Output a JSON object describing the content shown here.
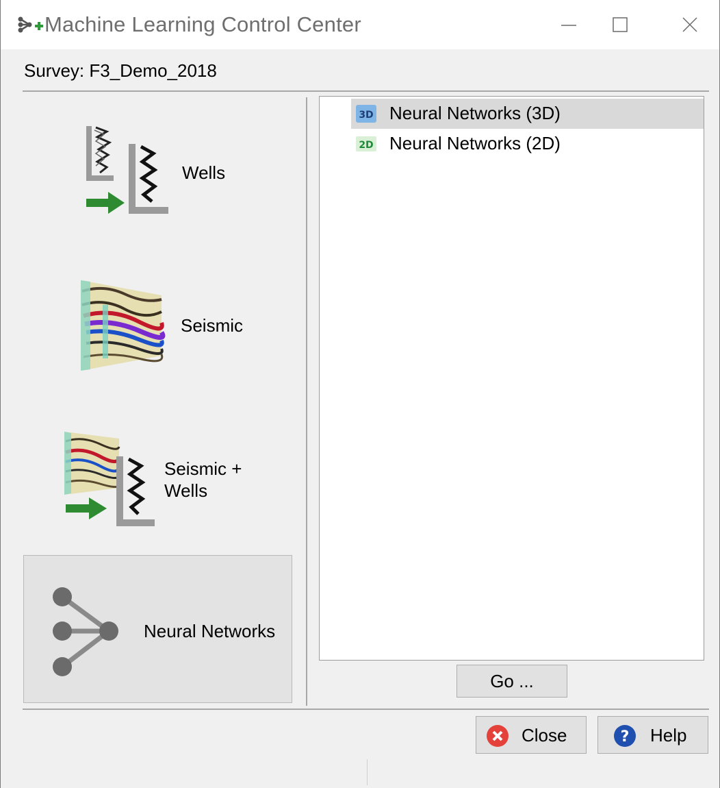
{
  "window": {
    "title": "Machine Learning Control Center",
    "icons": [
      "network-plus-icon",
      "minimize-icon",
      "maximize-icon",
      "window-close-icon"
    ]
  },
  "survey_label": "Survey: F3_Demo_2018",
  "categories": [
    {
      "label": "Wells",
      "icon": "wells-icon"
    },
    {
      "label": "Seismic",
      "icon": "seismic-icon"
    },
    {
      "label_line1": "Seismic +",
      "label_line2": "Wells",
      "icon": "seismic-wells-icon"
    },
    {
      "label": "Neural Networks",
      "icon": "neural-network-icon",
      "selected": true
    }
  ],
  "list": {
    "items": [
      {
        "label": "Neural Networks (3D)",
        "icon": "3d-icon",
        "selected": true
      },
      {
        "label": "Neural Networks (2D)",
        "icon": "2d-icon",
        "selected": false
      }
    ]
  },
  "buttons": {
    "go": "Go ...",
    "close": "Close",
    "help": "Help"
  },
  "colors": {
    "selection": "#d9d9d9",
    "close_icon": "#e4413b",
    "help_icon": "#1f4faf",
    "arrow_green": "#2e8b32"
  }
}
